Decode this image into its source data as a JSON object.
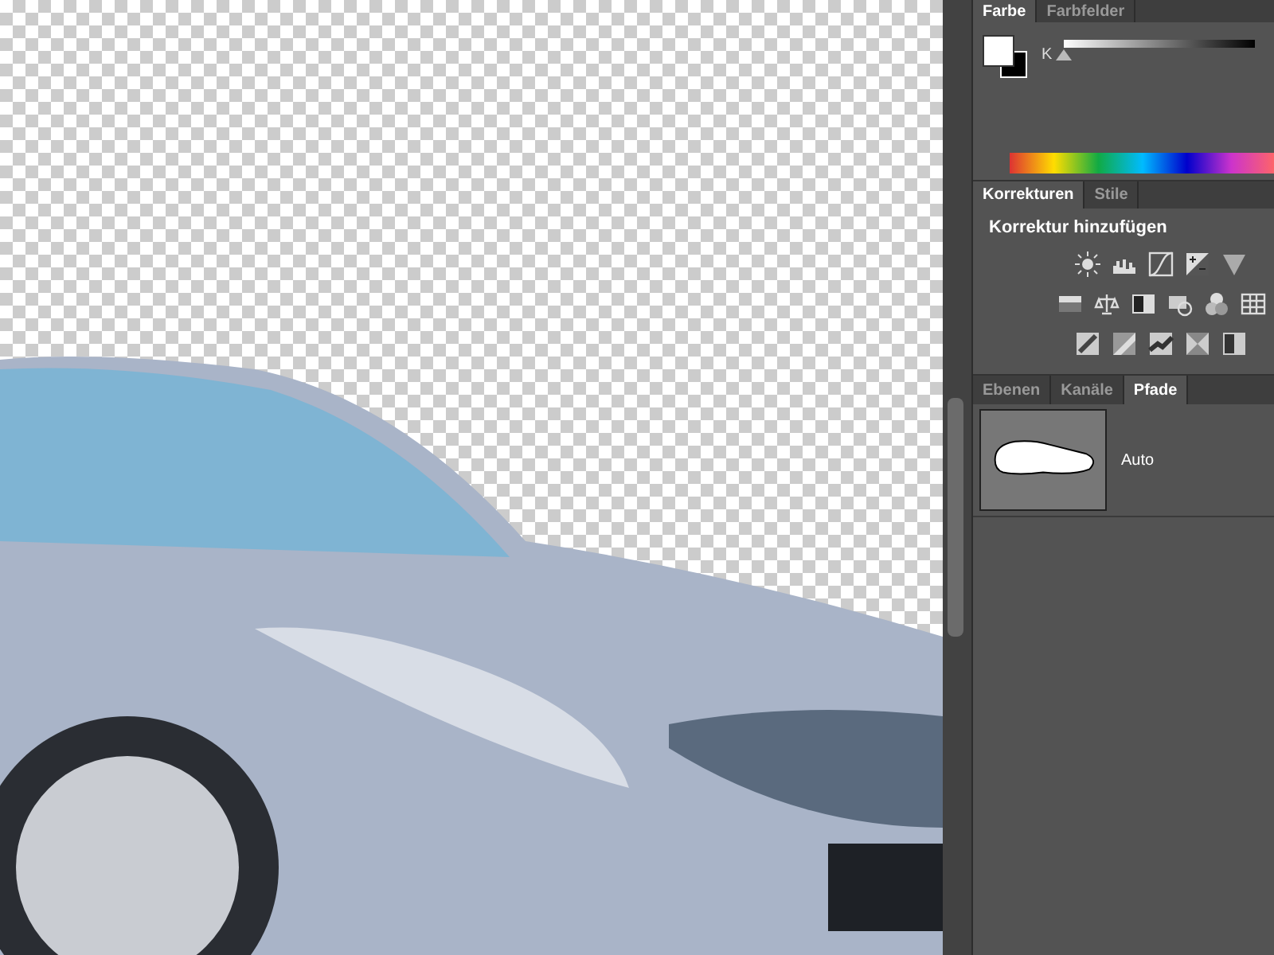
{
  "color_panel": {
    "tabs": [
      {
        "label": "Farbe",
        "selected": true
      },
      {
        "label": "Farbfelder",
        "selected": false
      }
    ],
    "channel_label": "K",
    "slider": {
      "level": 0
    }
  },
  "adjustments_panel": {
    "tabs": [
      {
        "label": "Korrekturen",
        "selected": true
      },
      {
        "label": "Stile",
        "selected": false
      }
    ],
    "heading": "Korrektur hinzufügen"
  },
  "paths_panel": {
    "tabs": [
      {
        "label": "Ebenen",
        "selected": false
      },
      {
        "label": "Kanäle",
        "selected": false
      },
      {
        "label": "Pfade",
        "selected": true
      }
    ],
    "paths": [
      {
        "name": "Auto"
      }
    ]
  }
}
